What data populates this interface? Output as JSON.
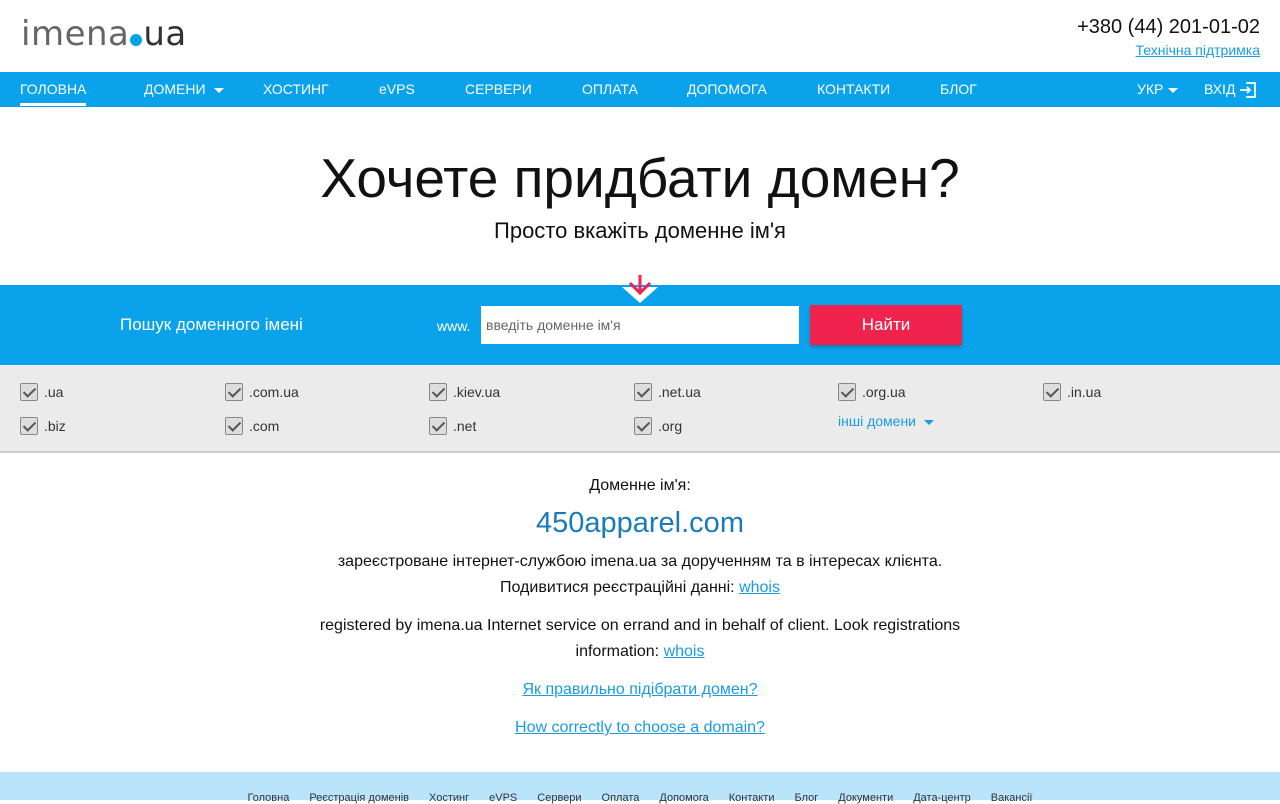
{
  "header": {
    "logo_main": "imena",
    "logo_tld": "ua",
    "phone": "+380 (44) 201-01-02",
    "support_link": "Технічна підтримка"
  },
  "nav": {
    "items": [
      {
        "label": "ГОЛОВНА",
        "active": true
      },
      {
        "label": "ДОМЕНИ",
        "has_dropdown": true
      },
      {
        "label": "ХОСТИНГ"
      },
      {
        "label": "eVPS"
      },
      {
        "label": "СЕРВЕРИ"
      },
      {
        "label": "ОПЛАТА"
      },
      {
        "label": "ДОПОМОГА"
      },
      {
        "label": "КОНТАКТИ"
      },
      {
        "label": "БЛОГ"
      }
    ],
    "language": "УКР",
    "login": "ВХІД"
  },
  "hero": {
    "title": "Хочете придбати домен?",
    "subtitle": "Просто вкажіть доменне ім'я"
  },
  "search": {
    "label": "Пошук доменного імені",
    "prefix": "www.",
    "placeholder": "введіть доменне ім'я",
    "button": "Найти"
  },
  "tlds": {
    "row1": [
      ".ua",
      ".com.ua",
      ".kiev.ua",
      ".net.ua",
      ".org.ua",
      ".in.ua"
    ],
    "row2": [
      ".biz",
      ".com",
      ".net",
      ".org"
    ],
    "other": "інші домени"
  },
  "content": {
    "domain_label": "Доменне ім'я:",
    "domain_name": "450apparel.com",
    "ua_text": "зареєстроване інтернет-службою imena.ua за дорученням та в інтересах клієнта.",
    "ua_whois_prefix": "Подивитися реєстраційні данні:",
    "whois": "whois",
    "en_text_1": "registered by imena.ua Internet service on errand and in behalf of client. Look registrations",
    "en_text_2_prefix": "information:",
    "ua_choose_link": "Як правильно підібрати домен?",
    "en_choose_link": "How correctly to choose a domain?"
  },
  "footer": {
    "links": [
      "Головна",
      "Реєстрація доменів",
      "Хостинг",
      "eVPS",
      "Сервери",
      "Оплата",
      "Допомога",
      "Контакти",
      "Блог",
      "Документи",
      "Дата-центр",
      "Вакансії"
    ]
  },
  "colors": {
    "brand_blue": "#0aa3eb",
    "search_button": "#f0234f",
    "arrow": "#f0234f",
    "link": "#1a9be0",
    "domain_name": "#1a7bb8",
    "footer_bg": "#b9e4fb"
  }
}
